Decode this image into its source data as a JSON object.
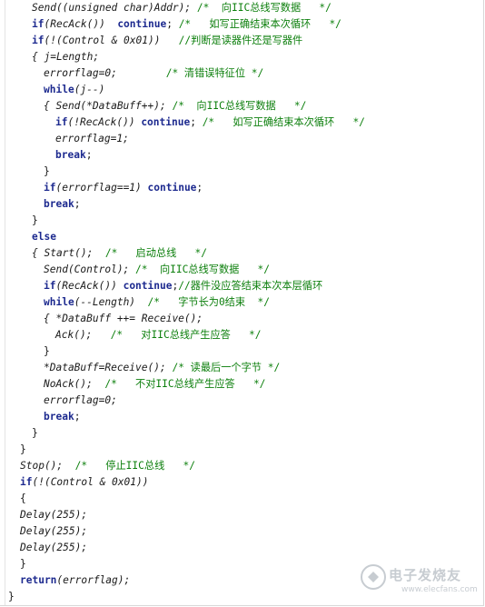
{
  "lines": [
    [
      {
        "t": "Send((unsigned char)Addr); ",
        "c": "it"
      },
      {
        "t": "/*  向IIC总线写数据   */",
        "c": "cm"
      }
    ],
    [
      {
        "t": "if",
        "c": "kw"
      },
      {
        "t": "(RecAck())  ",
        "c": "it"
      },
      {
        "t": "continue",
        "c": "kw"
      },
      {
        "t": "; ",
        "c": ""
      },
      {
        "t": "/*   如写正确结束本次循环   */",
        "c": "cm"
      }
    ],
    [
      {
        "t": "if",
        "c": "kw"
      },
      {
        "t": "(!(Control & 0x01))   ",
        "c": "it"
      },
      {
        "t": "//判断是读器件还是写器件",
        "c": "cm"
      }
    ],
    [
      {
        "t": "{ j=Length;",
        "c": "it"
      }
    ],
    [
      {
        "t": "errorflag=0;        ",
        "c": "it"
      },
      {
        "t": "/* 清错误特征位 */",
        "c": "cm"
      }
    ],
    [
      {
        "t": "while",
        "c": "kw"
      },
      {
        "t": "(j--)",
        "c": "it"
      }
    ],
    [
      {
        "t": "{ Send(*DataBuff++); ",
        "c": "it"
      },
      {
        "t": "/*  向IIC总线写数据   */",
        "c": "cm"
      }
    ],
    [
      {
        "t": "if",
        "c": "kw"
      },
      {
        "t": "(!RecAck()) ",
        "c": "it"
      },
      {
        "t": "continue",
        "c": "kw"
      },
      {
        "t": "; ",
        "c": ""
      },
      {
        "t": "/*   如写正确结束本次循环   */",
        "c": "cm"
      }
    ],
    [
      {
        "t": "errorflag=1;",
        "c": "it"
      }
    ],
    [
      {
        "t": "break",
        "c": "kw"
      },
      {
        "t": ";",
        "c": ""
      }
    ],
    [
      {
        "t": "}",
        "c": ""
      }
    ],
    [
      {
        "t": "if",
        "c": "kw"
      },
      {
        "t": "(errorflag==1) ",
        "c": "it"
      },
      {
        "t": "continue",
        "c": "kw"
      },
      {
        "t": ";",
        "c": ""
      }
    ],
    [
      {
        "t": "break",
        "c": "kw"
      },
      {
        "t": ";",
        "c": ""
      }
    ],
    [
      {
        "t": "}",
        "c": ""
      }
    ],
    [
      {
        "t": "else",
        "c": "kw"
      }
    ],
    [
      {
        "t": "{ Start();  ",
        "c": "it"
      },
      {
        "t": "/*   启动总线   */",
        "c": "cm"
      }
    ],
    [
      {
        "t": "Send(Control); ",
        "c": "it"
      },
      {
        "t": "/*  向IIC总线写数据   */",
        "c": "cm"
      }
    ],
    [
      {
        "t": "if",
        "c": "kw"
      },
      {
        "t": "(RecAck()) ",
        "c": "it"
      },
      {
        "t": "continue",
        "c": "kw"
      },
      {
        "t": ";",
        "c": ""
      },
      {
        "t": "//器件没应答结束本次本层循环",
        "c": "cm"
      }
    ],
    [
      {
        "t": "while",
        "c": "kw"
      },
      {
        "t": "(--Length)  ",
        "c": "it"
      },
      {
        "t": "/*   字节长为0结束  */",
        "c": "cm"
      }
    ],
    [
      {
        "t": "{ *DataBuff ++= Receive();",
        "c": "it"
      }
    ],
    [
      {
        "t": "Ack();   ",
        "c": "it"
      },
      {
        "t": "/*   对IIC总线产生应答   */",
        "c": "cm"
      }
    ],
    [
      {
        "t": "}",
        "c": ""
      }
    ],
    [
      {
        "t": "*DataBuff=Receive(); ",
        "c": "it"
      },
      {
        "t": "/* 读最后一个字节 */",
        "c": "cm"
      }
    ],
    [
      {
        "t": "NoAck();  ",
        "c": "it"
      },
      {
        "t": "/*   不对IIC总线产生应答   */",
        "c": "cm"
      }
    ],
    [
      {
        "t": "errorflag=0;",
        "c": "it"
      }
    ],
    [
      {
        "t": "break",
        "c": "kw"
      },
      {
        "t": ";",
        "c": ""
      }
    ],
    [
      {
        "t": "}",
        "c": ""
      }
    ],
    [
      {
        "t": "}",
        "c": ""
      }
    ],
    [
      {
        "t": "Stop();  ",
        "c": "it"
      },
      {
        "t": "/*   停止IIC总线   */",
        "c": "cm"
      }
    ],
    [
      {
        "t": "if",
        "c": "kw"
      },
      {
        "t": "(!(Control & 0x01))",
        "c": "it"
      }
    ],
    [
      {
        "t": "{",
        "c": ""
      }
    ],
    [
      {
        "t": "Delay(255);",
        "c": "it"
      }
    ],
    [
      {
        "t": "Delay(255);",
        "c": "it"
      }
    ],
    [
      {
        "t": "Delay(255);",
        "c": "it"
      }
    ],
    [
      {
        "t": "}",
        "c": ""
      }
    ],
    [
      {
        "t": "return",
        "c": "kw"
      },
      {
        "t": "(errorflag);",
        "c": "it"
      }
    ],
    [
      {
        "t": "}",
        "c": ""
      }
    ]
  ],
  "watermark": {
    "text": "电子发烧友",
    "url": "www.elecfans.com"
  }
}
